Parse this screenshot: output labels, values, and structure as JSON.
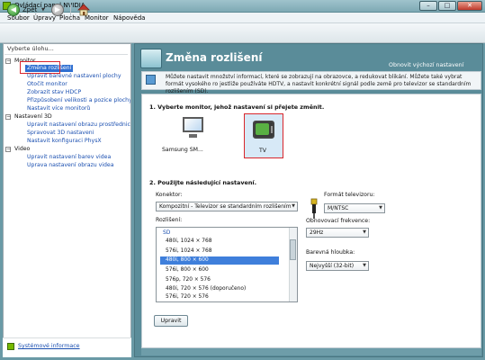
{
  "window": {
    "title": "Ovládací panel NVIDIA",
    "min": "–",
    "max": "□",
    "close": "✕"
  },
  "menu": [
    "Soubor",
    "Úpravy",
    "Plocha",
    "Monitor",
    "Nápověda"
  ],
  "toolbar": {
    "back_label": "Zpět"
  },
  "sidebar": {
    "title": "Vyberte úlohu...",
    "categories": {
      "monitor": "Monitor",
      "d3": "Nastavení 3D",
      "video": "Video"
    },
    "monitor_items": [
      "Změna rozlišení",
      "Upravit barevné nastavení plochy",
      "Otočit monitor",
      "Zobrazit stav HDCP",
      "Přizpůsobení velikosti a pozice plochy",
      "Nastavit více monitorů"
    ],
    "d3_items": [
      "Upravit nastavení obrazu prostřednictvím n",
      "Spravovat 3D nastavení",
      "Nastavit konfiguraci PhysX"
    ],
    "video_items": [
      "Upravit nastavení barev videa",
      "Úprava nastavení obrazu videa"
    ],
    "footer_link": "Systémové informace"
  },
  "main": {
    "title": "Změna rozlišení",
    "restore_defaults": "Obnovit výchozí nastavení",
    "description": "Můžete nastavit množství informací, které se zobrazují na obrazovce, a redukovat blikání. Můžete také vybrat formát vysokého ro jestliže používáte HDTV, a nastavit konkrétní signál podle země pro televizor se standardním rozlišením (SD).",
    "step1": "1. Vyberte monitor, jehož nastavení si přejete změnit.",
    "monitors": [
      "Samsung SM...",
      "TV"
    ],
    "step2": "2. Použijte následující nastavení.",
    "connector_label": "Konektor:",
    "connector_value": "Kompozitní - Televizor se standardním rozlišením",
    "tvformat_label": "Formát televizoru:",
    "tvformat_value": "M/NTSC",
    "resolution_label": "Rozlišení:",
    "resolutions": [
      "SD",
      "480i, 1024 × 768",
      "576i, 1024 × 768",
      "480i, 800 × 600",
      "576i, 800 × 600",
      "576p, 720 × 576",
      "480i, 720 × 576 (doporučeno)",
      "576i, 720 × 576"
    ],
    "refresh_label": "Obnovovací frekvence:",
    "refresh_value": "29Hz",
    "color_label": "Barevná hloubka:",
    "color_value": "Nejvyšší (32-bit)",
    "apply": "Upravit"
  }
}
